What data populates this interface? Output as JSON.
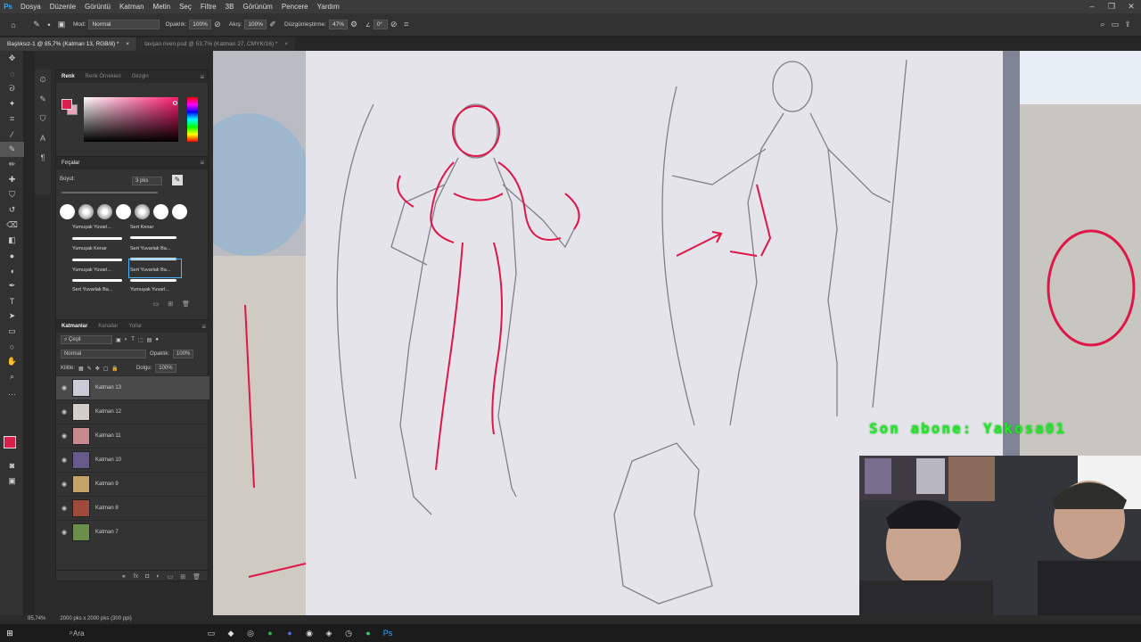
{
  "app": {
    "logo": "Ps",
    "menu": [
      "Dosya",
      "Düzenle",
      "Görüntü",
      "Katman",
      "Metin",
      "Seç",
      "Filtre",
      "3B",
      "Görünüm",
      "Pencere",
      "Yardım"
    ]
  },
  "options_bar": {
    "mode_label": "Mod:",
    "mode_value": "Normal",
    "opacity_label": "Opaklık:",
    "opacity_value": "100%",
    "flow_label": "Akış:",
    "flow_value": "100%",
    "smoothing_label": "Düzgünleştirme:",
    "smoothing_value": "47%",
    "angle_value": "0°"
  },
  "doc_tabs": [
    {
      "label": "Başlıksız-1 @ 85,7% (Katman 13, RGB/8) *",
      "close": "×"
    },
    {
      "label": "tavşan riven.psd @ 53,7% (Katman 27, CMYK/16) *",
      "close": "×"
    }
  ],
  "color_panel": {
    "tabs": [
      "Renk",
      "Renk Örnekleri",
      "Gezgin"
    ],
    "fg_color": "#d81f4d"
  },
  "brushes_panel": {
    "title": "Fırçalar",
    "size_label": "Boyut:",
    "size_value": "3 pks",
    "presets": [
      "Yumuşak Yuvarl...",
      "Sert Kenar",
      "Yumuşak Kenar",
      "Sert Yuvarlak Ba...",
      "Yumuşak Yuvarl...",
      "Sert Yuvarlak Ba...",
      "Sert Yuvarlak Ba...",
      "Yumuşak Yuvarl..."
    ]
  },
  "layers_panel": {
    "tabs": [
      "Katmanlar",
      "Kanallar",
      "Yollar"
    ],
    "filter_label": "Çeşit",
    "blend_mode": "Normal",
    "opacity_label": "Opaklık:",
    "opacity_value": "100%",
    "lock_label": "Kilitle:",
    "fill_label": "Dolgu:",
    "fill_value": "100%",
    "layers": [
      "Katman 13",
      "Katman 12",
      "Katman 11",
      "Katman 10",
      "Katman 9",
      "Katman 8",
      "Katman 7"
    ]
  },
  "status": {
    "zoom": "85,74%",
    "doc_size": "2000 pks x 2000 pks (300 ppi)"
  },
  "overlay_text": "Son abone: Yakosa01",
  "taskbar": {
    "search_label": "Ara"
  }
}
